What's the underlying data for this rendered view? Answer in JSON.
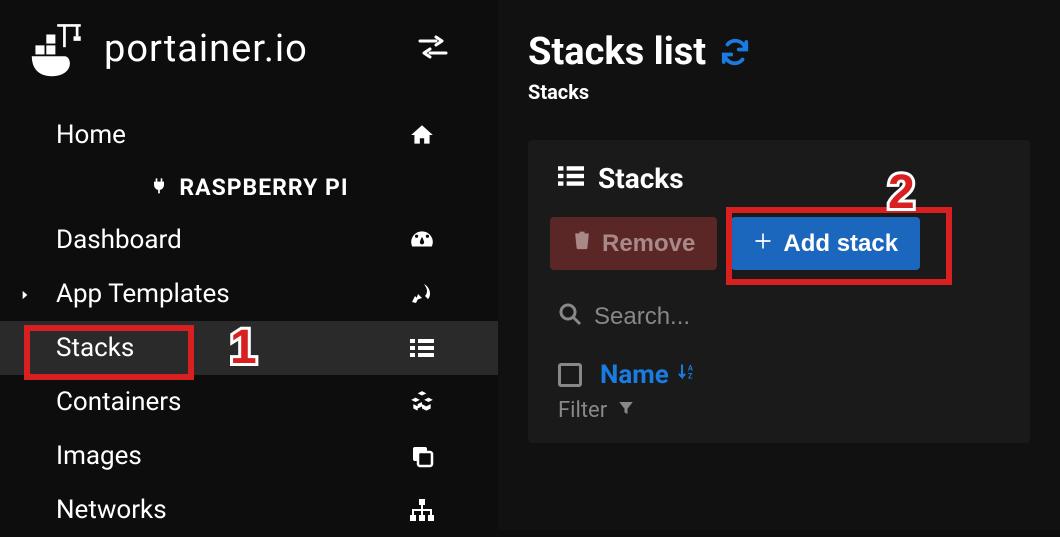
{
  "logo_text": "portainer.io",
  "sidebar": {
    "home": "Home",
    "endpoint": "RASPBERRY PI",
    "dashboard": "Dashboard",
    "app_templates": "App Templates",
    "stacks": "Stacks",
    "containers": "Containers",
    "images": "Images",
    "networks": "Networks"
  },
  "header": {
    "title": "Stacks list",
    "breadcrumb": "Stacks"
  },
  "panel": {
    "title": "Stacks",
    "remove_label": "Remove",
    "add_label": "Add stack",
    "search_placeholder": "Search...",
    "col_name": "Name",
    "filter_label": "Filter"
  },
  "annotations": {
    "badge1": "1",
    "badge2": "2"
  },
  "colors": {
    "highlight": "#d82020",
    "accent": "#1a7be0",
    "btn_primary": "#1c67be"
  }
}
